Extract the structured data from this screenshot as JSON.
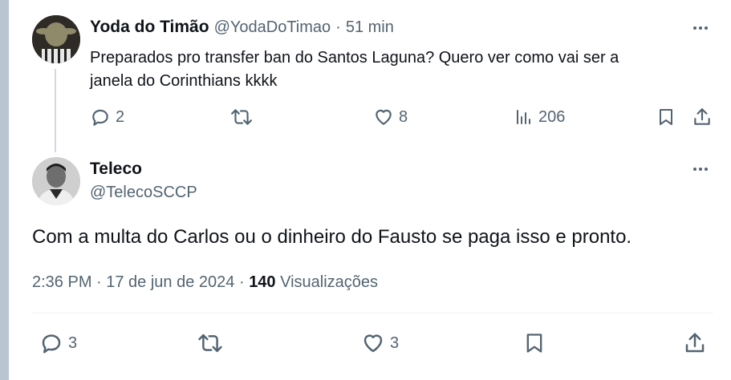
{
  "reply_tweet": {
    "name": "Yoda do Timão",
    "handle": "@YodaDoTimao",
    "separator": "·",
    "time": "51 min",
    "text_line1": "Preparados pro transfer ban do Santos Laguna? Quero ver como vai ser a",
    "text_line2": "janela do Corinthians kkkk",
    "actions": {
      "replies": "2",
      "retweets": "",
      "likes": "8",
      "views": "206"
    }
  },
  "main_tweet": {
    "name": "Teleco",
    "handle": "@TelecoSCCP",
    "text": "Com a multa do Carlos ou o dinheiro do Fausto se paga isso e pronto.",
    "timestamp": "2:36 PM · 17 de jun de 2024 ·",
    "views_count": "140",
    "views_label": "Visualizações",
    "actions": {
      "replies": "3",
      "retweets": "",
      "likes": "3"
    }
  },
  "colors": {
    "text": "#0f1419",
    "muted": "#536471",
    "divider": "#eff3f4",
    "thread_line": "#cfd9de"
  }
}
